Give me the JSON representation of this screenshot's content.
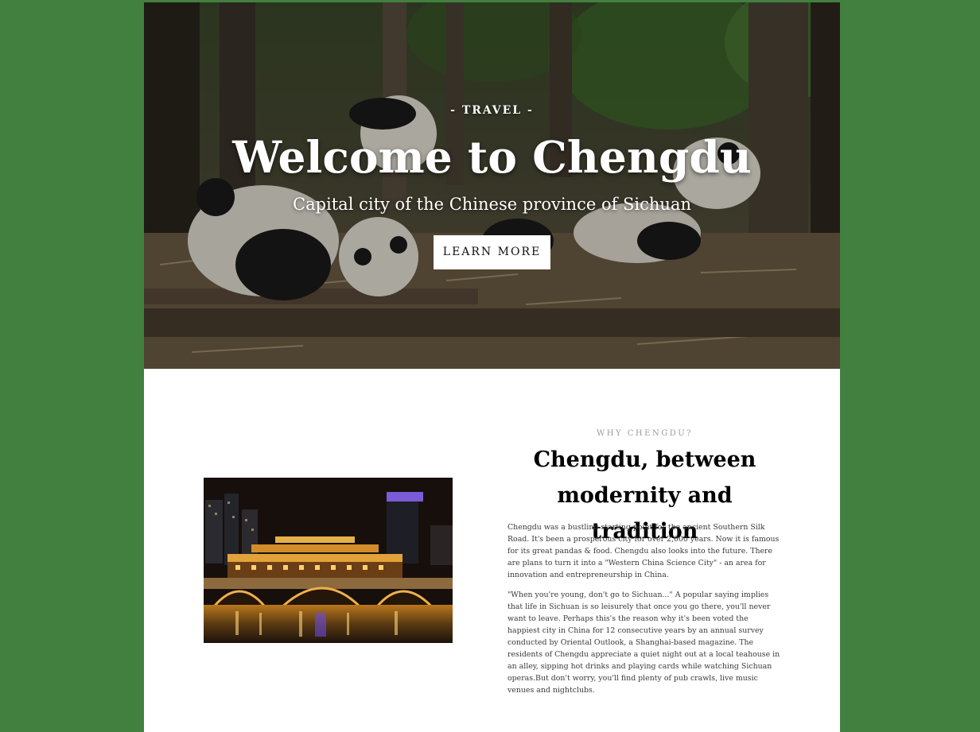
{
  "hero": {
    "kicker": "- TRAVEL -",
    "title": "Welcome to Chengdu",
    "subtitle": "Capital city of the Chinese province of Sichuan",
    "button_label": "LEARN MORE"
  },
  "why": {
    "kicker": "WHY CHENGDU?",
    "heading": "Chengdu, between modernity and tradition",
    "paragraphs": [
      "Chengdu was a bustling starting point for the ancient Southern Silk Road. It's been a prosperous city for over 2,000 years. Now it is famous for its great pandas & food. Chengdu also looks into the future. There are plans to turn it into a \"Western China Science City\" - an area for innovation and entrepreneurship in China.",
      "\"When you're young, don't go to Sichuan...\" A popular saying implies that life in Sichuan is so leisurely that once you go there, you'll never want to leave. Perhaps this's the reason why it's been voted the happiest city in China for 12 consecutive years by an annual survey conducted by Oriental Outlook, a Shanghai-based magazine. The residents of Chengdu appreciate a quiet night out at a local teahouse in an alley, sipping hot drinks and playing cards while watching Sichuan operas.But don't worry, you'll find plenty of pub crawls, live music venues and nightclubs."
    ]
  },
  "colors": {
    "page_background": "#428040",
    "content_background": "#ffffff",
    "hero_text": "#ffffff",
    "kicker_gray": "#9b9b9b",
    "body_text": "#3a3a3a"
  }
}
